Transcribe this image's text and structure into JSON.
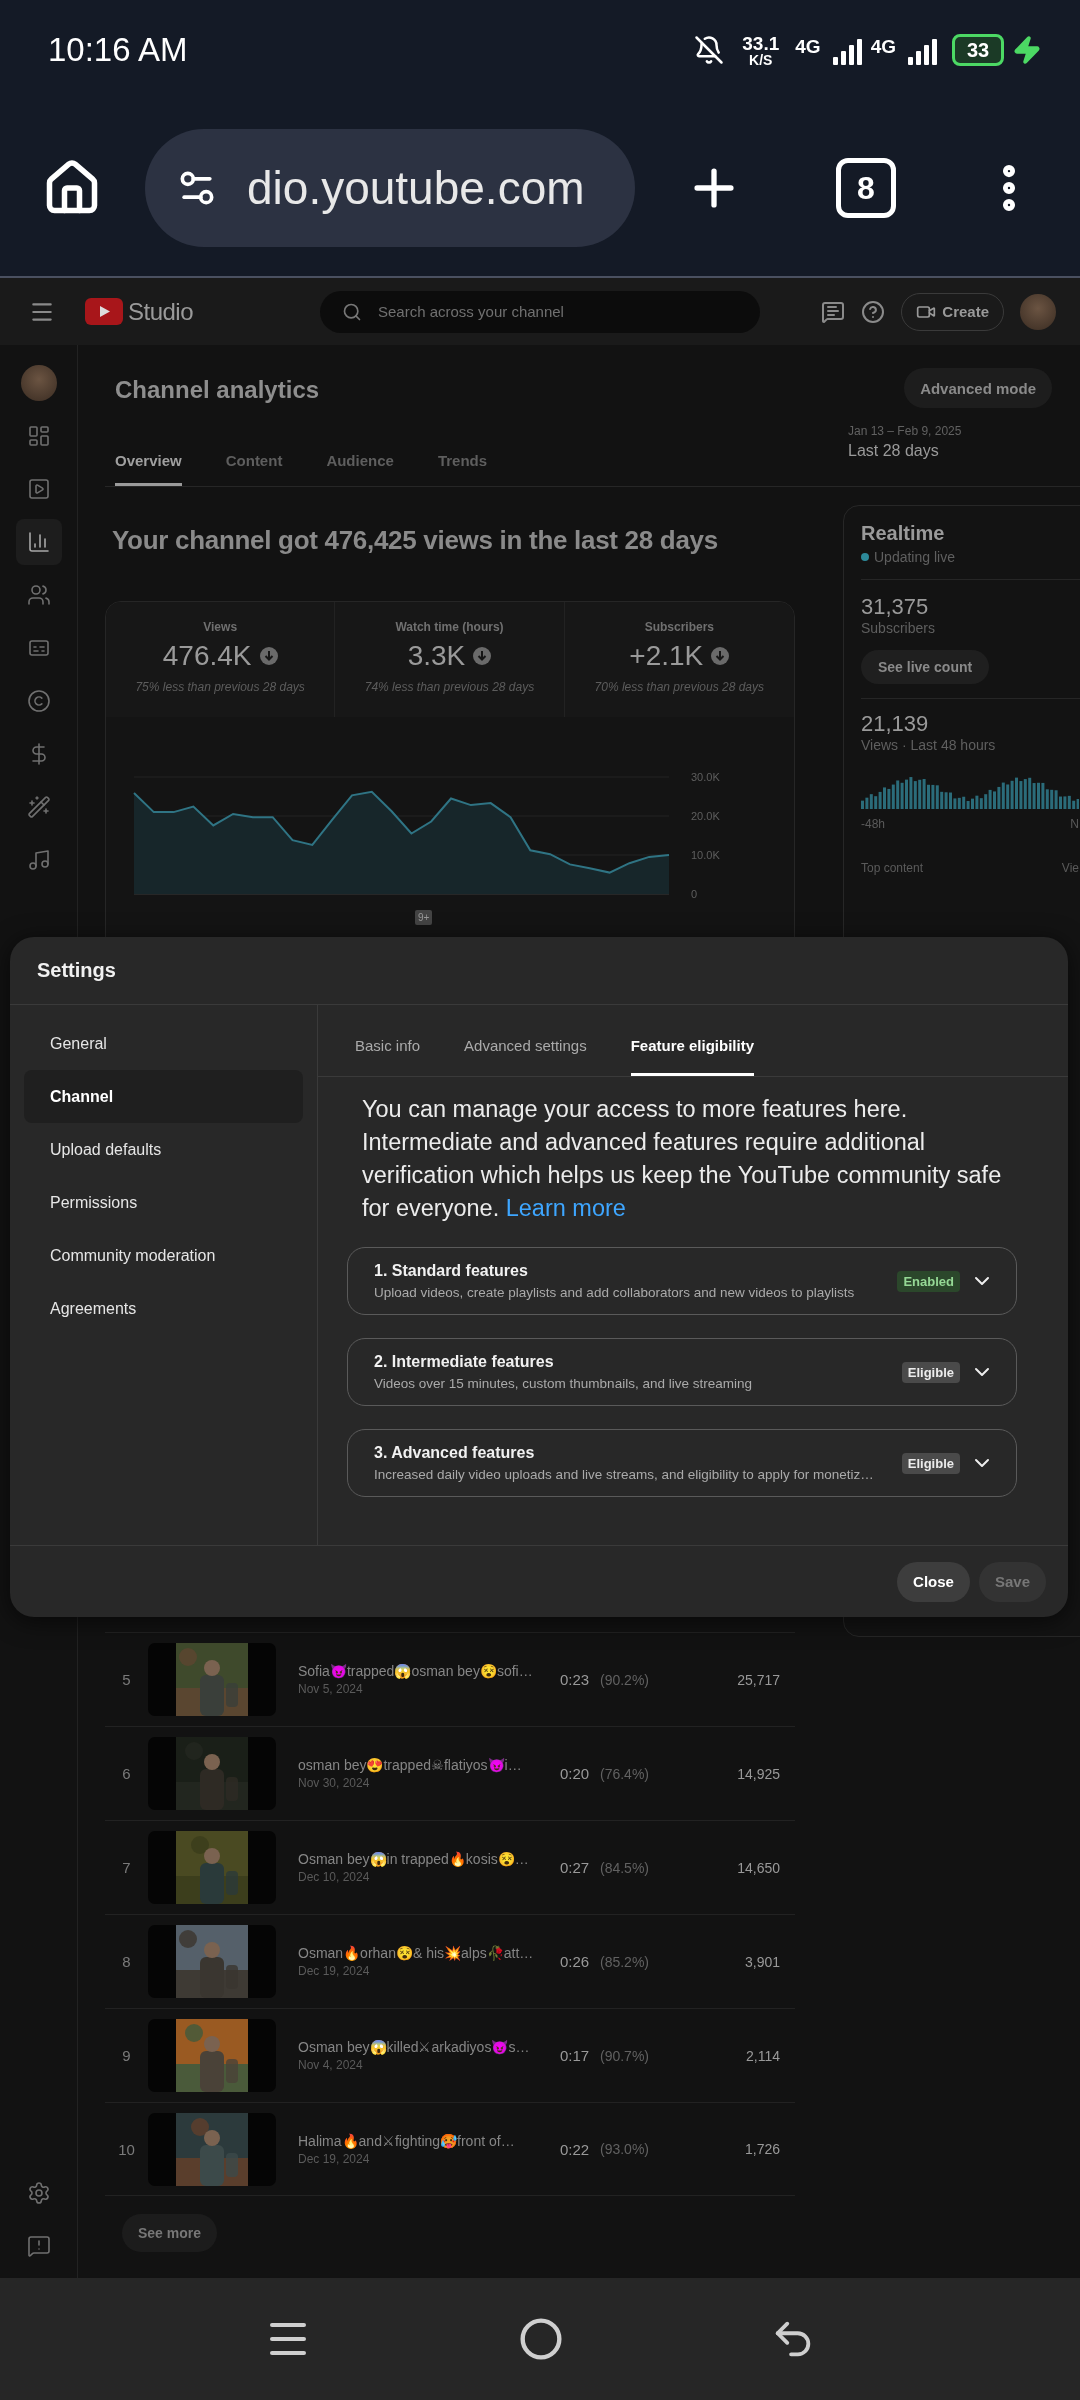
{
  "status_bar": {
    "time": "10:16 AM",
    "speed": "33.1",
    "speed_unit": "K/S",
    "network_1": "4G",
    "network_2": "4G",
    "battery": "33"
  },
  "browser": {
    "url": "dio.youtube.com",
    "tab_count": "8"
  },
  "studio_header": {
    "logo": "Studio",
    "search": {
      "placeholder": "Search across your channel"
    },
    "create": "Create"
  },
  "nav_rail": [
    {
      "kind": "dashboard",
      "selected": false
    },
    {
      "kind": "content",
      "selected": false
    },
    {
      "kind": "analytics",
      "selected": true
    },
    {
      "kind": "community",
      "selected": false
    },
    {
      "kind": "subtitles",
      "selected": false
    },
    {
      "kind": "copyright",
      "selected": false
    },
    {
      "kind": "earn",
      "selected": false
    },
    {
      "kind": "customization",
      "selected": false
    },
    {
      "kind": "audio_library",
      "selected": false
    }
  ],
  "analytics": {
    "title": "Channel analytics",
    "advanced_mode": "Advanced mode",
    "date_range": "Jan 13 – Feb 9, 2025",
    "period": "Last 28 days",
    "tabs": [
      {
        "label": "Overview",
        "selected": true
      },
      {
        "label": "Content",
        "selected": false
      },
      {
        "label": "Audience",
        "selected": false
      },
      {
        "label": "Trends",
        "selected": false
      }
    ],
    "headline": "Your channel got 476,425 views in the last 28 days",
    "metrics": [
      {
        "label": "Views",
        "value": "476.4K",
        "note": "75% less than previous 28 days"
      },
      {
        "label": "Watch time (hours)",
        "value": "3.3K",
        "note": "74% less than previous 28 days"
      },
      {
        "label": "Subscribers",
        "value": "+2.1K",
        "note": "70% less than previous 28 days"
      }
    ],
    "chart_badge": "9+",
    "chart_data": {
      "type": "area",
      "ylim": [
        0,
        30000
      ],
      "yticks": [
        {
          "value": 0,
          "label": "0"
        },
        {
          "value": 10000,
          "label": "10.0K"
        },
        {
          "value": 20000,
          "label": "20.0K"
        },
        {
          "value": 30000,
          "label": "30.0K"
        }
      ],
      "values": [
        25900,
        21000,
        21000,
        22400,
        17600,
        20500,
        19700,
        19700,
        13800,
        12600,
        19000,
        25300,
        26200,
        21200,
        15500,
        18600,
        24500,
        22800,
        23300,
        19700,
        11200,
        10200,
        7600,
        6600,
        5500,
        7900,
        9500,
        10000
      ]
    }
  },
  "realtime": {
    "title": "Realtime",
    "status": "Updating live",
    "subscribers": "31,375",
    "subscribers_label": "Subscribers",
    "live_count_button": "See live count",
    "views": "21,139",
    "views_label": "Views · Last 48 hours",
    "axis_start": "-48h",
    "axis_end": "N",
    "top_content": "Top content",
    "column_label": "Vie"
  },
  "top_videos": {
    "rows": [
      {
        "rank": "5",
        "title": "Sofia😈trapped😱osman bey😵sofi…",
        "date": "Nov 5, 2024",
        "duration": "0:23",
        "percent": "(90.2%)",
        "views": "25,717"
      },
      {
        "rank": "6",
        "title": "osman bey😍trapped☠flatiyos😈i…",
        "date": "Nov 30, 2024",
        "duration": "0:20",
        "percent": "(76.4%)",
        "views": "14,925"
      },
      {
        "rank": "7",
        "title": "Osman bey😱in trapped🔥kosis😵…",
        "date": "Dec 10, 2024",
        "duration": "0:27",
        "percent": "(84.5%)",
        "views": "14,650"
      },
      {
        "rank": "8",
        "title": "Osman🔥orhan😵& his💥alps🥀att…",
        "date": "Dec 19, 2024",
        "duration": "0:26",
        "percent": "(85.2%)",
        "views": "3,901"
      },
      {
        "rank": "9",
        "title": "Osman bey😱killed⚔arkadiyos😈s…",
        "date": "Nov 4, 2024",
        "duration": "0:17",
        "percent": "(90.7%)",
        "views": "2,114"
      },
      {
        "rank": "10",
        "title": "Halima🔥and⚔fighting🥵front of…",
        "date": "Dec 19, 2024",
        "duration": "0:22",
        "percent": "(93.0%)",
        "views": "1,726"
      }
    ],
    "see_more": "See more"
  },
  "settings_dialog": {
    "title": "Settings",
    "nav": [
      {
        "label": "General",
        "selected": false
      },
      {
        "label": "Channel",
        "selected": true
      },
      {
        "label": "Upload defaults",
        "selected": false
      },
      {
        "label": "Permissions",
        "selected": false
      },
      {
        "label": "Community moderation",
        "selected": false
      },
      {
        "label": "Agreements",
        "selected": false
      }
    ],
    "tabs": [
      {
        "label": "Basic info",
        "selected": false
      },
      {
        "label": "Advanced settings",
        "selected": false
      },
      {
        "label": "Feature eligibility",
        "selected": true
      }
    ],
    "intro": "You can manage your access to more features here. Intermediate and advanced features require additional verification which helps us keep the YouTube community safe for everyone.",
    "learn_more": "Learn more",
    "features": [
      {
        "title": "1. Standard features",
        "description": "Upload videos, create playlists and add collaborators and new videos to playlists",
        "badge": "Enabled",
        "kind": "enabled"
      },
      {
        "title": "2. Intermediate features",
        "description": "Videos over 15 minutes, custom thumbnails, and live streaming",
        "badge": "Eligible",
        "kind": "eligible"
      },
      {
        "title": "3. Advanced features",
        "description": "Increased daily video uploads and live streams, and eligibility to apply for monetiz…",
        "badge": "Eligible",
        "kind": "eligible"
      }
    ],
    "buttons": [
      {
        "label": "Close",
        "disabled": false
      },
      {
        "label": "Save",
        "disabled": true
      }
    ]
  }
}
